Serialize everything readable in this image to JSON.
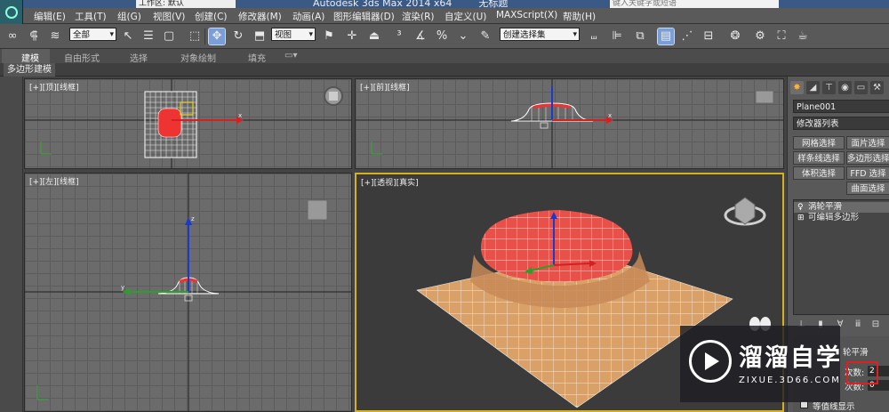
{
  "window": {
    "title": "Autodesk 3ds Max  2014 x64",
    "doc_title": "无标题",
    "workspace": "工作区: 默认",
    "search_placeholder": "键入关键字或短语"
  },
  "menu": [
    "编辑(E)",
    "工具(T)",
    "组(G)",
    "视图(V)",
    "创建(C)",
    "修改器(M)",
    "动画(A)",
    "图形编辑器(D)",
    "渲染(R)",
    "自定义(U)",
    "MAXScript(X)",
    "帮助(H)"
  ],
  "toolbar": {
    "selection_filter": "全部",
    "ref_coord": "视图",
    "named_selection": "创建选择集"
  },
  "ribbon": {
    "tabs": [
      "建模",
      "自由形式",
      "选择",
      "对象绘制",
      "填充"
    ],
    "active_tab": "建模",
    "sub_tab": "多边形建模"
  },
  "viewports": {
    "top": "[+][顶][线框]",
    "front": "[+][前][线框]",
    "left": "[+][左][线框]",
    "perspective": "[+][透视][真实]"
  },
  "axes": {
    "x": "x",
    "y": "y",
    "z": "z"
  },
  "command_panel": {
    "object_name": "Plane001",
    "modifier_list": "修改器列表",
    "buttons": [
      "网格选择",
      "面片选择",
      "样条线选择",
      "多边形选择",
      "体积选择",
      "FFD 选择",
      "曲面选择"
    ],
    "stack": [
      "涡轮平滑",
      "可编辑多边形"
    ],
    "rollout_title": "轮平滑",
    "iterations_label": "次数:",
    "iterations_value": "2",
    "render_iters_label": "次数:",
    "render_iters_value": "0",
    "isoline_label": "等值线显示"
  },
  "watermark": {
    "title": "溜溜自学",
    "url": "ZIXUE.3D66.COM"
  },
  "colors": {
    "accent_selected": "#7a9ed8",
    "viewport_active_border": "#d6b020",
    "highlight_red": "#e02020",
    "mesh_orange": "#d9a068",
    "mesh_selected": "#e8504a"
  }
}
